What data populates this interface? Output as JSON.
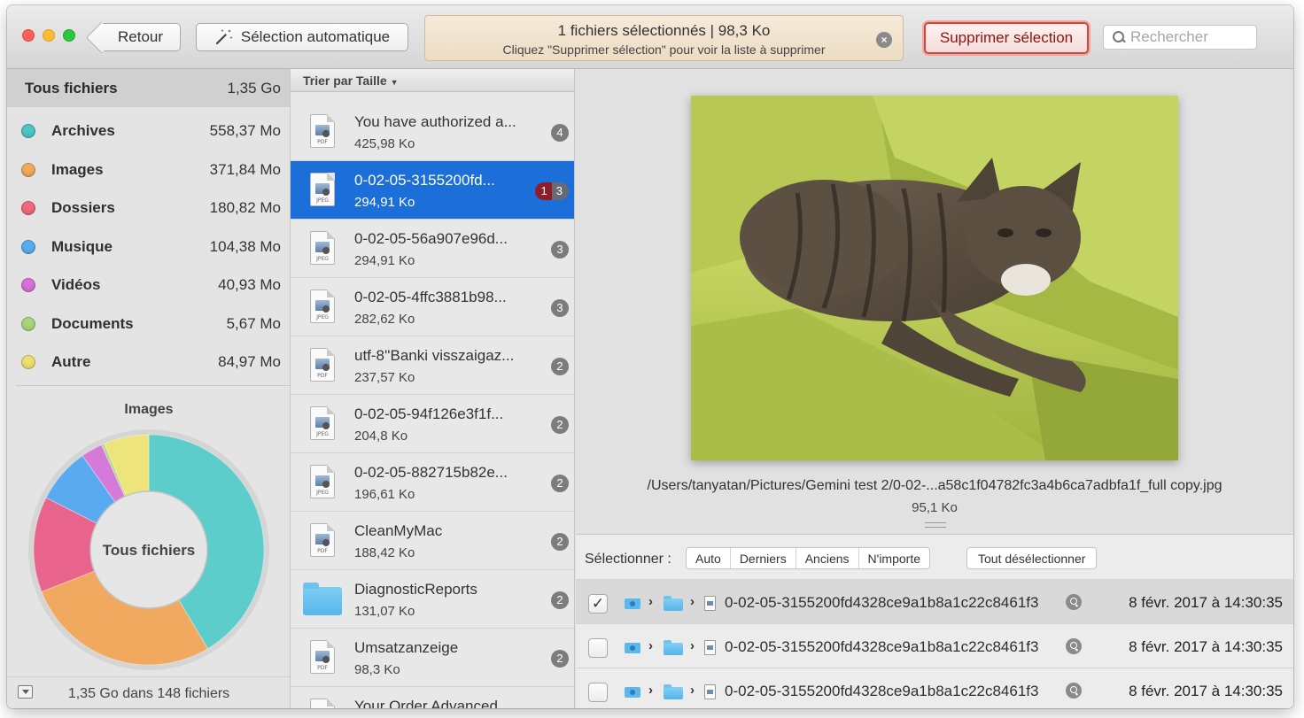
{
  "toolbar": {
    "back_label": "Retour",
    "auto_label": "Sélection automatique",
    "notice_line1": "1 fichiers sélectionnés | 98,3 Ko",
    "notice_line2": "Cliquez \"Supprimer sélection\" pour voir la liste à supprimer",
    "delete_label": "Supprimer sélection",
    "search_placeholder": "Rechercher"
  },
  "sidebar": {
    "all_label": "Tous fichiers",
    "all_size": "1,35 Go",
    "categories": [
      {
        "name": "Archives",
        "size": "558,37 Mo",
        "color": "#4fc6c4"
      },
      {
        "name": "Images",
        "size": "371,84 Mo",
        "color": "#f0a95e"
      },
      {
        "name": "Dossiers",
        "size": "180,82 Mo",
        "color": "#f06a7c"
      },
      {
        "name": "Musique",
        "size": "104,38 Mo",
        "color": "#58aef0"
      },
      {
        "name": "Vidéos",
        "size": "40,93 Mo",
        "color": "#d872d8"
      },
      {
        "name": "Documents",
        "size": "5,67 Mo",
        "color": "#a9d57c"
      },
      {
        "name": "Autre",
        "size": "84,97 Mo",
        "color": "#ece072"
      }
    ],
    "chart_title": "Images",
    "chart_center": "Tous fichiers",
    "footer_text": "1,35 Go dans 148 fichiers"
  },
  "chart_data": {
    "type": "pie",
    "categories": [
      "Archives",
      "Images",
      "Dossiers",
      "Musique",
      "Vidéos",
      "Documents",
      "Autre"
    ],
    "values": [
      558.37,
      371.84,
      180.82,
      104.38,
      40.93,
      5.67,
      84.97
    ],
    "colors": [
      "#5ccdcb",
      "#f0a95e",
      "#e9648d",
      "#5aaaf0",
      "#d57ad8",
      "#b5d987",
      "#ede57b"
    ],
    "center_label": "Tous fichiers",
    "title": "Images"
  },
  "filelist": {
    "sort_label": "Trier par Taille",
    "files": [
      {
        "name": "You have authorized a...",
        "size": "425,98 Ko",
        "type": "PDF",
        "badge": "4"
      },
      {
        "name": "0-02-05-3155200fd...",
        "size": "294,91 Ko",
        "type": "JPEG",
        "badge_selected": "1",
        "badge": "3",
        "selected": true
      },
      {
        "name": "0-02-05-56a907e96d...",
        "size": "294,91 Ko",
        "type": "JPEG",
        "badge": "3"
      },
      {
        "name": "0-02-05-4ffc3881b98...",
        "size": "282,62 Ko",
        "type": "JPEG",
        "badge": "3"
      },
      {
        "name": "utf-8''Banki visszaigaz...",
        "size": "237,57 Ko",
        "type": "PDF",
        "badge": "2"
      },
      {
        "name": "0-02-05-94f126e3f1f...",
        "size": "204,8 Ko",
        "type": "JPEG",
        "badge": "2"
      },
      {
        "name": "0-02-05-882715b82e...",
        "size": "196,61 Ko",
        "type": "JPEG",
        "badge": "2"
      },
      {
        "name": "CleanMyMac",
        "size": "188,42 Ko",
        "type": "PDF",
        "badge": "2"
      },
      {
        "name": "DiagnosticReports",
        "size": "131,07 Ko",
        "type": "folder",
        "badge": "2"
      },
      {
        "name": "Umsatzanzeige",
        "size": "98,3 Ko",
        "type": "PDF",
        "badge": "2"
      },
      {
        "name": "Your Order Advanced",
        "size": "",
        "type": "PDF",
        "badge": ""
      }
    ]
  },
  "preview": {
    "path": "/Users/tanyatan/Pictures/Gemini test 2/0-02-...a58c1f04782fc3a4b6ca7adbfa1f_full copy.jpg",
    "size": "95,1 Ko"
  },
  "selection": {
    "label": "Sélectionner :",
    "options": [
      "Auto",
      "Derniers",
      "Anciens",
      "N'importe"
    ],
    "deselect_label": "Tout désélectionner",
    "rows": [
      {
        "checked": true,
        "name": "0-02-05-3155200fd4328ce9a1b8a1c22c8461f3",
        "date": "8 févr. 2017 à 14:30:35"
      },
      {
        "checked": false,
        "name": "0-02-05-3155200fd4328ce9a1b8a1c22c8461f3",
        "date": "8 févr. 2017 à 14:30:35"
      },
      {
        "checked": false,
        "name": "0-02-05-3155200fd4328ce9a1b8a1c22c8461f3",
        "date": "8 févr. 2017 à 14:30:35"
      }
    ]
  }
}
